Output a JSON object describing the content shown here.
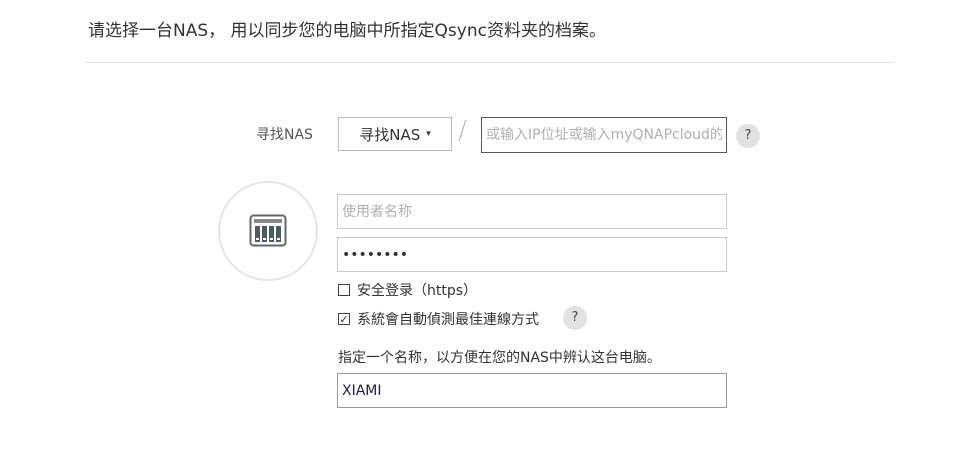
{
  "header": {
    "instruction": "请选择一台NAS， 用以同步您的电脑中所指定Qsync资料夹的档案。"
  },
  "find": {
    "label": "寻找NAS",
    "button_label": "寻找NAS",
    "caret": "▾",
    "separator": "/",
    "ip_placeholder": "或输入IP位址或输入myQNAPcloud的网址",
    "help": "?"
  },
  "login": {
    "icon": "nas-device-icon",
    "username_placeholder": "使用者名称",
    "password_value": "********",
    "secure_login_label": "安全登录（https）",
    "secure_login_checked": false,
    "auto_detect_label": "系統會自動偵測最佳連線方式",
    "auto_detect_checked": true,
    "help": "?"
  },
  "computer_name": {
    "label": "指定一个名称，以方便在您的NAS中辨认这台电脑。",
    "value": "XIAMI"
  },
  "colors": {
    "text": "#333333",
    "placeholder": "#b0b0b0",
    "border": "#c8c8c8",
    "help_bg": "#e2e2e2",
    "name_value": "#1a1a6a"
  }
}
